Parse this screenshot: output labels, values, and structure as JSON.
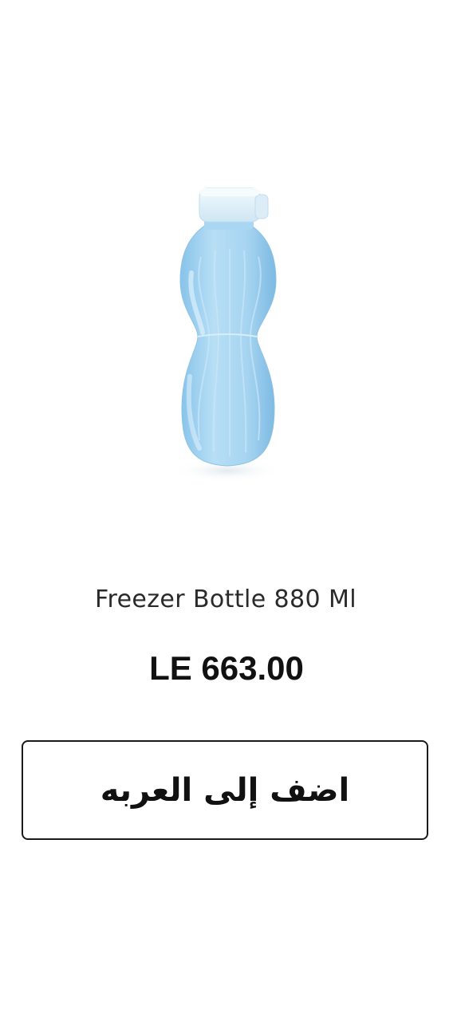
{
  "product": {
    "name": "Freezer Bottle 880 Ml",
    "price": "LE 663.00",
    "image_icon": "water-bottle-icon",
    "bottle_color": "#9fd0ef",
    "cap_color": "#e3f2fb"
  },
  "actions": {
    "add_to_cart_label": "اضف إلى العربه"
  }
}
